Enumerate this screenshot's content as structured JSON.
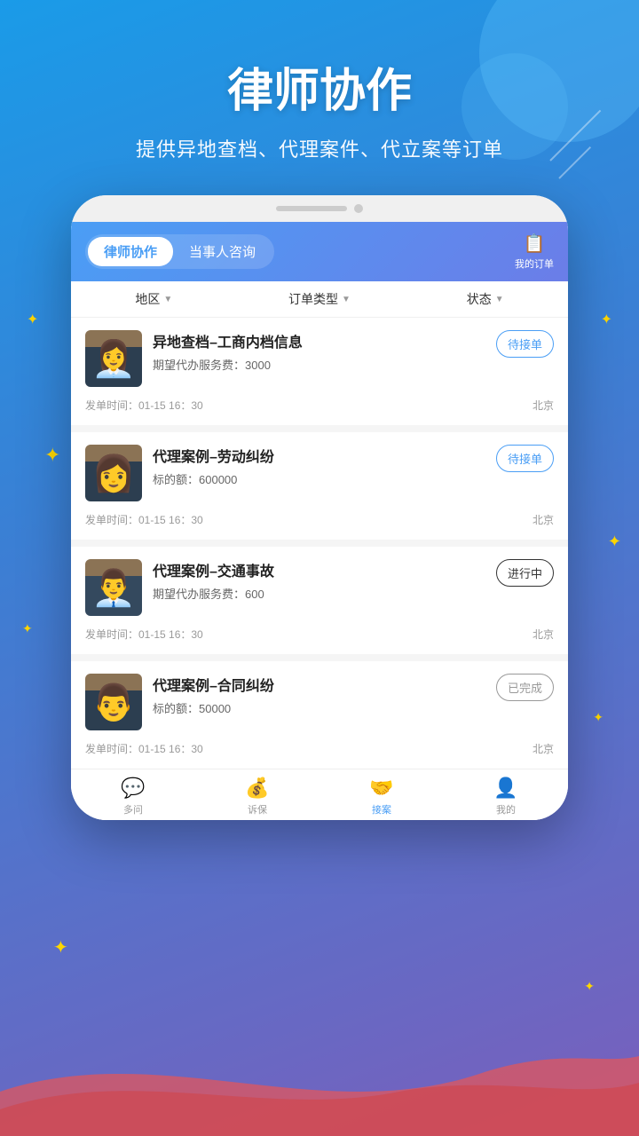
{
  "header": {
    "title": "律师协作",
    "subtitle": "提供异地查档、代理案件、代立案等订单"
  },
  "tabs": [
    {
      "label": "律师协作",
      "active": true
    },
    {
      "label": "当事人咨询",
      "active": false
    }
  ],
  "my_orders_label": "我的订单",
  "filters": [
    {
      "label": "地区",
      "id": "region"
    },
    {
      "label": "订单类型",
      "id": "order-type"
    },
    {
      "label": "状态",
      "id": "status"
    }
  ],
  "orders": [
    {
      "id": 1,
      "title": "异地查档–工商内档信息",
      "detail_label": "期望代办服务费：",
      "detail_value": "3000",
      "time": "发单时间：01-15 16：30",
      "location": "北京",
      "status": "待接单",
      "status_type": "pending"
    },
    {
      "id": 2,
      "title": "代理案例–劳动纠纷",
      "detail_label": "标的额：",
      "detail_value": "600000",
      "time": "发单时间：01-15 16：30",
      "location": "北京",
      "status": "待接单",
      "status_type": "pending"
    },
    {
      "id": 3,
      "title": "代理案例–交通事故",
      "detail_label": "期望代办服务费：",
      "detail_value": "600",
      "time": "发单时间：01-15 16：30",
      "location": "北京",
      "status": "进行中",
      "status_type": "ongoing"
    },
    {
      "id": 4,
      "title": "代理案例–合同纠纷",
      "detail_label": "标的额：",
      "detail_value": "50000",
      "time": "发单时间：01-15 16：30",
      "location": "北京",
      "status": "已完成",
      "status_type": "completed"
    }
  ],
  "bottom_nav": [
    {
      "label": "多问",
      "icon": "💬",
      "active": false
    },
    {
      "label": "诉保",
      "icon": "💰",
      "active": false
    },
    {
      "label": "接案",
      "icon": "🤝",
      "active": true
    },
    {
      "label": "我的",
      "icon": "👤",
      "active": false
    }
  ],
  "decorations": {
    "stars": [
      "✦",
      "✦",
      "✦",
      "✦",
      "✦"
    ]
  }
}
